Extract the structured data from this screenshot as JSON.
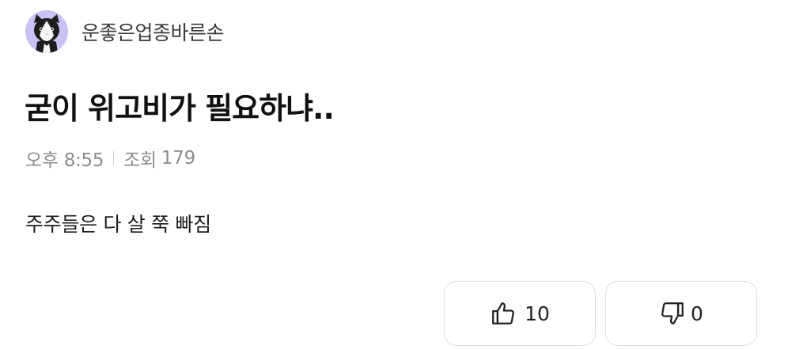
{
  "post": {
    "author": {
      "name": "운좋은업종바른손",
      "avatar_icon": "cat-avatar-icon",
      "avatar_bg": "#c9c2f4"
    },
    "title": "굳이 위고비가 필요하냐..",
    "meta": {
      "time": "오후 8:55",
      "views_label": "조회",
      "views": "179"
    },
    "body": "주주들은 다 살 쭉 빠짐"
  },
  "reactions": {
    "like": {
      "icon": "thumbs-up-icon",
      "count": "10"
    },
    "dislike": {
      "icon": "thumbs-down-icon",
      "count": "0"
    }
  }
}
